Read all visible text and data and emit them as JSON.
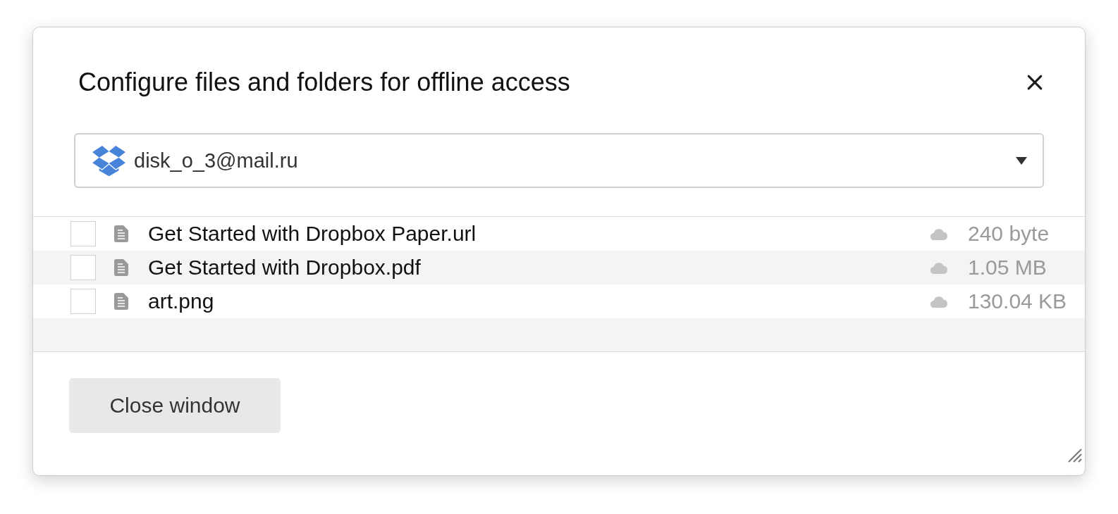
{
  "dialog": {
    "title": "Configure files and folders for offline access",
    "account_select": {
      "value": "disk_o_3@mail.ru"
    },
    "files": [
      {
        "name": "Get Started with Dropbox Paper.url",
        "size": "240 byte",
        "checked": false
      },
      {
        "name": "Get Started with Dropbox.pdf",
        "size": "1.05 MB",
        "checked": false
      },
      {
        "name": "art.png",
        "size": "130.04 KB",
        "checked": false
      }
    ],
    "footer_buttons": [
      {
        "label": "Close window"
      }
    ]
  }
}
